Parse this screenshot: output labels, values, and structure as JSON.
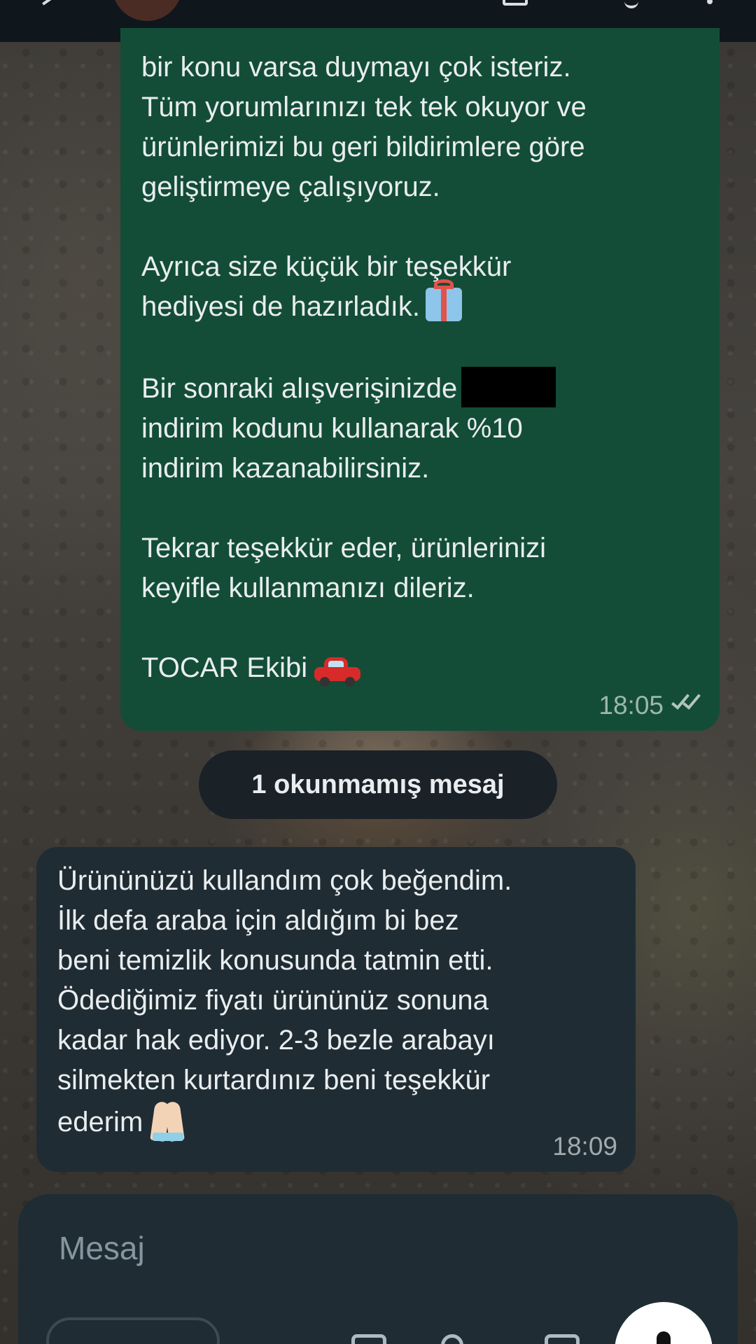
{
  "header": {
    "back_icon": "arrow-left-icon",
    "video_icon": "video-camera-icon",
    "call_icon": "phone-icon",
    "menu_icon": "more-vertical-icon"
  },
  "outgoing_message": {
    "lines": [
      "bir konu varsa duymayı çok isteriz.",
      "Tüm yorumlarınızı tek tek okuyor ve",
      "ürünlerimizi bu geri bildirimlere göre",
      "geliştirmeye çalışıyoruz.",
      "Ayrıca size küçük bir teşekkür",
      "hediyesi de hazırladık.",
      "Bir sonraki alışverişinizde",
      "indirim kodunu kullanarak %10",
      "indirim kazanabilirsiniz.",
      "Tekrar teşekkür eder, ürünlerinizi",
      "keyifle kullanmanızı dileriz.",
      "TOCAR Ekibi"
    ],
    "time": "18:05",
    "status_icon": "double-check-icon",
    "emojis": [
      "gift-icon",
      "car-icon"
    ]
  },
  "unread_divider": {
    "label": "1 okunmamış mesaj"
  },
  "incoming_message": {
    "lines": [
      "Ürününüzü kullandım çok beğendim.",
      "İlk defa araba için aldığım bi bez",
      "beni temizlik konusunda tatmin etti.",
      "Ödediğimiz fiyatı ürününüz sonuna",
      "kadar hak ediyor. 2-3 bezle arabayı",
      "silmekten kurtardınız beni teşekkür",
      "ederim"
    ],
    "time": "18:09",
    "emojis": [
      "folded-hands-icon"
    ]
  },
  "composer": {
    "placeholder": "Mesaj",
    "icons": [
      "emoji-icon",
      "attach-icon",
      "camera-icon",
      "microphone-icon"
    ]
  },
  "colors": {
    "outgoing_bubble": "#134d37",
    "incoming_bubble": "#1f2c33",
    "header": "#0f171c",
    "text": "#e9edef"
  }
}
